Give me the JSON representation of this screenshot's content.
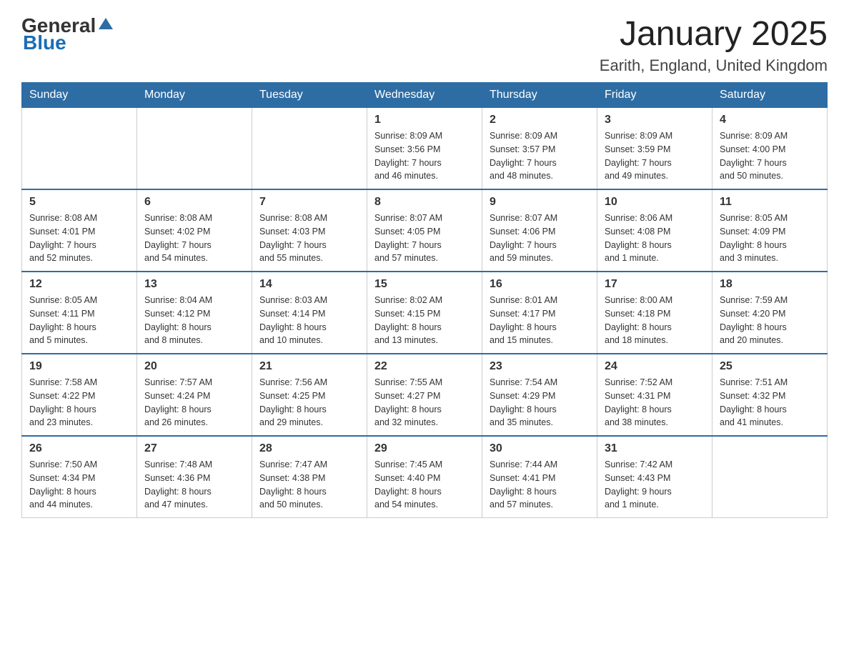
{
  "logo": {
    "general_text": "General",
    "blue_text": "Blue"
  },
  "header": {
    "title": "January 2025",
    "subtitle": "Earith, England, United Kingdom"
  },
  "days_of_week": [
    "Sunday",
    "Monday",
    "Tuesday",
    "Wednesday",
    "Thursday",
    "Friday",
    "Saturday"
  ],
  "weeks": [
    [
      {
        "day": "",
        "info": ""
      },
      {
        "day": "",
        "info": ""
      },
      {
        "day": "",
        "info": ""
      },
      {
        "day": "1",
        "info": "Sunrise: 8:09 AM\nSunset: 3:56 PM\nDaylight: 7 hours\nand 46 minutes."
      },
      {
        "day": "2",
        "info": "Sunrise: 8:09 AM\nSunset: 3:57 PM\nDaylight: 7 hours\nand 48 minutes."
      },
      {
        "day": "3",
        "info": "Sunrise: 8:09 AM\nSunset: 3:59 PM\nDaylight: 7 hours\nand 49 minutes."
      },
      {
        "day": "4",
        "info": "Sunrise: 8:09 AM\nSunset: 4:00 PM\nDaylight: 7 hours\nand 50 minutes."
      }
    ],
    [
      {
        "day": "5",
        "info": "Sunrise: 8:08 AM\nSunset: 4:01 PM\nDaylight: 7 hours\nand 52 minutes."
      },
      {
        "day": "6",
        "info": "Sunrise: 8:08 AM\nSunset: 4:02 PM\nDaylight: 7 hours\nand 54 minutes."
      },
      {
        "day": "7",
        "info": "Sunrise: 8:08 AM\nSunset: 4:03 PM\nDaylight: 7 hours\nand 55 minutes."
      },
      {
        "day": "8",
        "info": "Sunrise: 8:07 AM\nSunset: 4:05 PM\nDaylight: 7 hours\nand 57 minutes."
      },
      {
        "day": "9",
        "info": "Sunrise: 8:07 AM\nSunset: 4:06 PM\nDaylight: 7 hours\nand 59 minutes."
      },
      {
        "day": "10",
        "info": "Sunrise: 8:06 AM\nSunset: 4:08 PM\nDaylight: 8 hours\nand 1 minute."
      },
      {
        "day": "11",
        "info": "Sunrise: 8:05 AM\nSunset: 4:09 PM\nDaylight: 8 hours\nand 3 minutes."
      }
    ],
    [
      {
        "day": "12",
        "info": "Sunrise: 8:05 AM\nSunset: 4:11 PM\nDaylight: 8 hours\nand 5 minutes."
      },
      {
        "day": "13",
        "info": "Sunrise: 8:04 AM\nSunset: 4:12 PM\nDaylight: 8 hours\nand 8 minutes."
      },
      {
        "day": "14",
        "info": "Sunrise: 8:03 AM\nSunset: 4:14 PM\nDaylight: 8 hours\nand 10 minutes."
      },
      {
        "day": "15",
        "info": "Sunrise: 8:02 AM\nSunset: 4:15 PM\nDaylight: 8 hours\nand 13 minutes."
      },
      {
        "day": "16",
        "info": "Sunrise: 8:01 AM\nSunset: 4:17 PM\nDaylight: 8 hours\nand 15 minutes."
      },
      {
        "day": "17",
        "info": "Sunrise: 8:00 AM\nSunset: 4:18 PM\nDaylight: 8 hours\nand 18 minutes."
      },
      {
        "day": "18",
        "info": "Sunrise: 7:59 AM\nSunset: 4:20 PM\nDaylight: 8 hours\nand 20 minutes."
      }
    ],
    [
      {
        "day": "19",
        "info": "Sunrise: 7:58 AM\nSunset: 4:22 PM\nDaylight: 8 hours\nand 23 minutes."
      },
      {
        "day": "20",
        "info": "Sunrise: 7:57 AM\nSunset: 4:24 PM\nDaylight: 8 hours\nand 26 minutes."
      },
      {
        "day": "21",
        "info": "Sunrise: 7:56 AM\nSunset: 4:25 PM\nDaylight: 8 hours\nand 29 minutes."
      },
      {
        "day": "22",
        "info": "Sunrise: 7:55 AM\nSunset: 4:27 PM\nDaylight: 8 hours\nand 32 minutes."
      },
      {
        "day": "23",
        "info": "Sunrise: 7:54 AM\nSunset: 4:29 PM\nDaylight: 8 hours\nand 35 minutes."
      },
      {
        "day": "24",
        "info": "Sunrise: 7:52 AM\nSunset: 4:31 PM\nDaylight: 8 hours\nand 38 minutes."
      },
      {
        "day": "25",
        "info": "Sunrise: 7:51 AM\nSunset: 4:32 PM\nDaylight: 8 hours\nand 41 minutes."
      }
    ],
    [
      {
        "day": "26",
        "info": "Sunrise: 7:50 AM\nSunset: 4:34 PM\nDaylight: 8 hours\nand 44 minutes."
      },
      {
        "day": "27",
        "info": "Sunrise: 7:48 AM\nSunset: 4:36 PM\nDaylight: 8 hours\nand 47 minutes."
      },
      {
        "day": "28",
        "info": "Sunrise: 7:47 AM\nSunset: 4:38 PM\nDaylight: 8 hours\nand 50 minutes."
      },
      {
        "day": "29",
        "info": "Sunrise: 7:45 AM\nSunset: 4:40 PM\nDaylight: 8 hours\nand 54 minutes."
      },
      {
        "day": "30",
        "info": "Sunrise: 7:44 AM\nSunset: 4:41 PM\nDaylight: 8 hours\nand 57 minutes."
      },
      {
        "day": "31",
        "info": "Sunrise: 7:42 AM\nSunset: 4:43 PM\nDaylight: 9 hours\nand 1 minute."
      },
      {
        "day": "",
        "info": ""
      }
    ]
  ]
}
